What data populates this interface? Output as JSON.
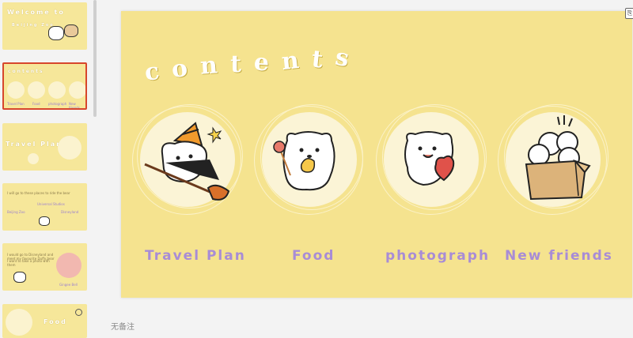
{
  "thumbnails": {
    "items": [
      {
        "caption": "Welcome to",
        "subcaption": "Beijing Zoo"
      },
      {
        "caption": "contents",
        "labels": [
          "Travel Plan",
          "Food",
          "photograph",
          "New friends"
        ]
      },
      {
        "caption": "Travel Plan"
      },
      {
        "caption": "",
        "lines": [
          "I will go to these places to ride the bear",
          "Beijing Zoo",
          "Universal Studios",
          "Disneyland"
        ]
      },
      {
        "caption": "",
        "lines": [
          "I would go to Disneyland and meet my favourite Duffy bear",
          "I want to take a photo with them",
          "Gingee Bell"
        ]
      },
      {
        "caption": "Food"
      }
    ]
  },
  "slide": {
    "title_letters": [
      "c",
      "o",
      "n",
      "t",
      "e",
      "n",
      "t",
      "s"
    ],
    "items": [
      {
        "label": "Travel Plan",
        "icon": "witch-bear-icon"
      },
      {
        "label": "Food",
        "icon": "bear-lollipop-icon"
      },
      {
        "label": "photograph",
        "icon": "bear-heart-icon"
      },
      {
        "label": "New friends",
        "icon": "bears-in-box-icon"
      }
    ]
  },
  "notes": {
    "placeholder": "无备注"
  },
  "colors": {
    "slide_bg": "#f5e38f",
    "label": "#a88cd6",
    "selected_border": "#d7462c"
  }
}
